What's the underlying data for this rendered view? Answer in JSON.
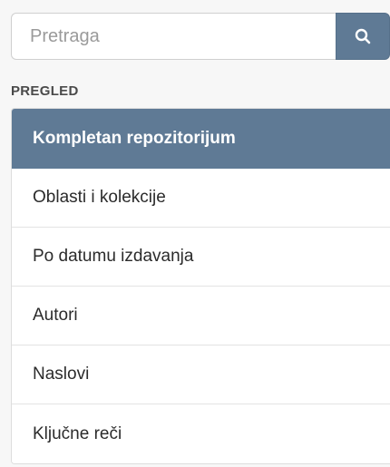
{
  "search": {
    "placeholder": "Pretraga",
    "button_icon": "search-icon",
    "accent": "#5f7a95"
  },
  "browse": {
    "heading": "PREGLED",
    "items": [
      {
        "label": "Kompletan repozitorijum",
        "active": true
      },
      {
        "label": "Oblasti i kolekcije",
        "active": false
      },
      {
        "label": "Po datumu izdavanja",
        "active": false
      },
      {
        "label": "Autori",
        "active": false
      },
      {
        "label": "Naslovi",
        "active": false
      },
      {
        "label": "Ključne reči",
        "active": false
      }
    ]
  }
}
